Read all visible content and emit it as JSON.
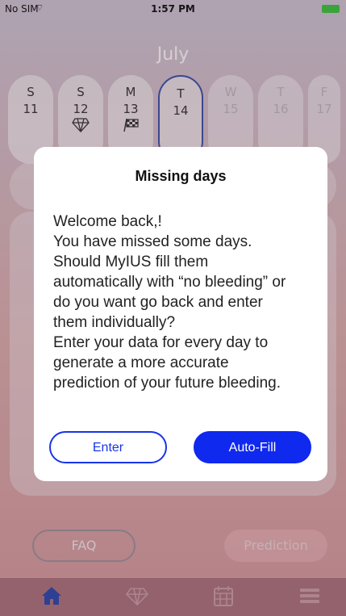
{
  "status": {
    "carrier": "No SIM",
    "time": "1:57 PM"
  },
  "calendar": {
    "month": "July",
    "days": [
      {
        "name": "S",
        "num": "11",
        "icon": ""
      },
      {
        "name": "S",
        "num": "12",
        "icon": "diamond-icon"
      },
      {
        "name": "M",
        "num": "13",
        "icon": "checkered-flag-icon"
      },
      {
        "name": "T",
        "num": "14",
        "icon": ""
      },
      {
        "name": "W",
        "num": "15",
        "icon": ""
      },
      {
        "name": "T",
        "num": "16",
        "icon": ""
      },
      {
        "name": "F",
        "num": "17",
        "icon": ""
      }
    ]
  },
  "buttons": {
    "faq": "FAQ",
    "prediction": "Prediction"
  },
  "tabs": [
    {
      "name": "home-icon",
      "active": true
    },
    {
      "name": "diamond-icon",
      "active": false
    },
    {
      "name": "calendar-icon",
      "active": false
    },
    {
      "name": "menu-icon",
      "active": false
    }
  ],
  "dialog": {
    "title": "Missing days",
    "lines": [
      "Welcome back,!",
      "You have missed some days.",
      "Should MyIUS fill them",
      "automatically with “no bleeding” or",
      "do you want go back and enter",
      "them individually?",
      "Enter your data for every day to",
      "generate a more accurate",
      "prediction of your future bleeding."
    ],
    "enter_label": "Enter",
    "autofill_label": "Auto-Fill"
  },
  "colors": {
    "accent": "#1029ee",
    "today_border": "#3a4fa6",
    "tab_active": "#2b46a8"
  }
}
